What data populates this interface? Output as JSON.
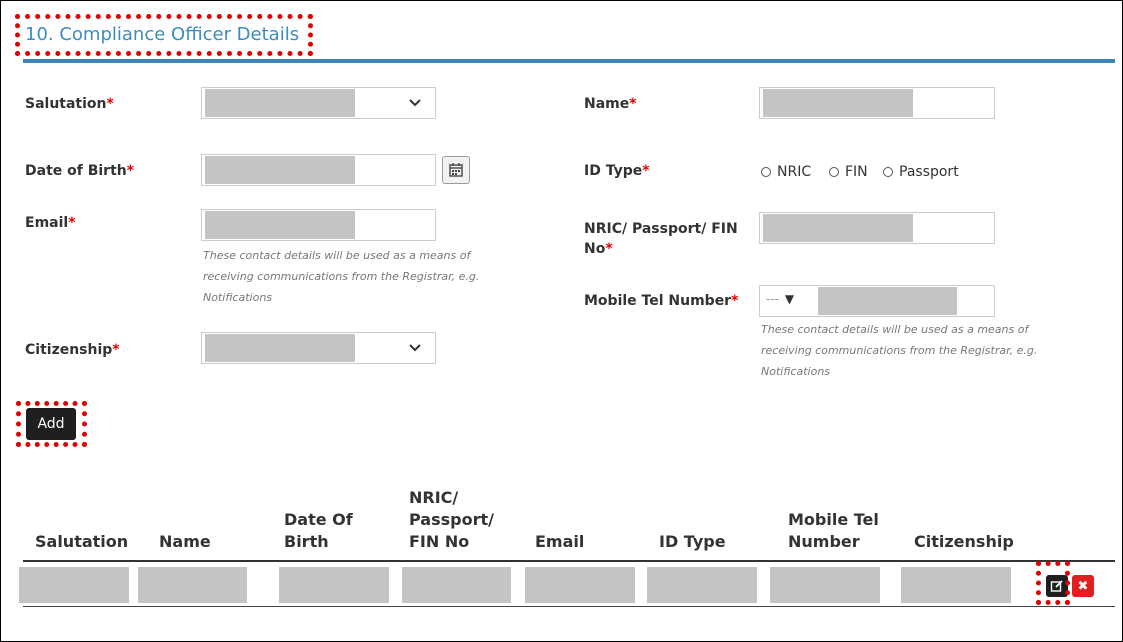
{
  "section": {
    "title": "10. Compliance Officer Details"
  },
  "form": {
    "salutation": {
      "label": "Salutation",
      "required": "*"
    },
    "date_of_birth": {
      "label": "Date of Birth",
      "required": "*"
    },
    "email": {
      "label": "Email",
      "required": "*",
      "hint_lines": [
        "These contact details will be used as a means of",
        "receiving communications from the Registrar, e.g.",
        "Notifications"
      ]
    },
    "citizenship": {
      "label": "Citizenship",
      "required": "*"
    },
    "name": {
      "label": "Name",
      "required": "*"
    },
    "id_type": {
      "label": "ID Type",
      "required": "*",
      "options": [
        "NRIC",
        "FIN",
        "Passport"
      ]
    },
    "id_number": {
      "label_line1": "NRIC/ Passport/ FIN",
      "label_line2": "No",
      "required": "*"
    },
    "mobile": {
      "label": "Mobile Tel Number",
      "required": "*",
      "country_code_placeholder": "---",
      "dropdown_glyph": "▼",
      "hint_lines": [
        "These contact details will be used as a means of",
        "receiving communications from the Registrar, e.g.",
        "Notifications"
      ]
    }
  },
  "actions": {
    "add_label": "Add"
  },
  "table": {
    "columns": [
      {
        "lines": [
          "Salutation"
        ]
      },
      {
        "lines": [
          "Name"
        ]
      },
      {
        "lines": [
          "Date Of",
          "Birth"
        ]
      },
      {
        "lines": [
          "NRIC/",
          "Passport/",
          "FIN No"
        ]
      },
      {
        "lines": [
          "Email"
        ]
      },
      {
        "lines": [
          "ID Type"
        ]
      },
      {
        "lines": [
          "Mobile Tel",
          "Number"
        ]
      },
      {
        "lines": [
          "Citizenship"
        ]
      }
    ],
    "delete_glyph": "✖"
  },
  "icons": {
    "dropdown": "chevron-down-icon",
    "calendar": "calendar-icon",
    "edit": "edit-icon",
    "delete": "delete-icon"
  },
  "colors": {
    "title": "#3c8dbc",
    "rule": "#3d86b8",
    "required": "#e00000",
    "redaction": "#c4c4c4",
    "button_dark": "#1f1f1f",
    "delete_red": "#e02020",
    "highlight": "#e00000"
  }
}
